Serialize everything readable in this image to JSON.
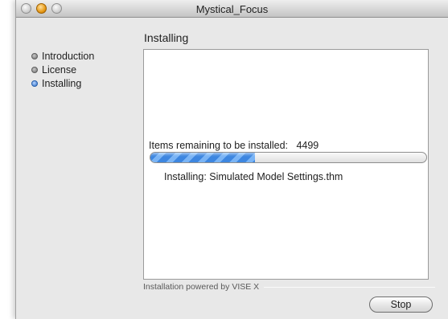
{
  "window": {
    "title": "Mystical_Focus"
  },
  "heading": "Installing",
  "steps": [
    {
      "label": "Introduction",
      "active": false
    },
    {
      "label": "License",
      "active": false
    },
    {
      "label": "Installing",
      "active": true
    }
  ],
  "install": {
    "remaining_label": "Items remaining to be installed:",
    "remaining_count": "4499",
    "progress_fraction": 0.38,
    "current_file": "Installing: Simulated Model Settings.thm"
  },
  "footer": {
    "powered_by": "Installation powered by VISE X"
  },
  "buttons": {
    "stop": "Stop"
  },
  "colors": {
    "progress": "#3d86e0",
    "active_step": "#2f6fc7"
  }
}
